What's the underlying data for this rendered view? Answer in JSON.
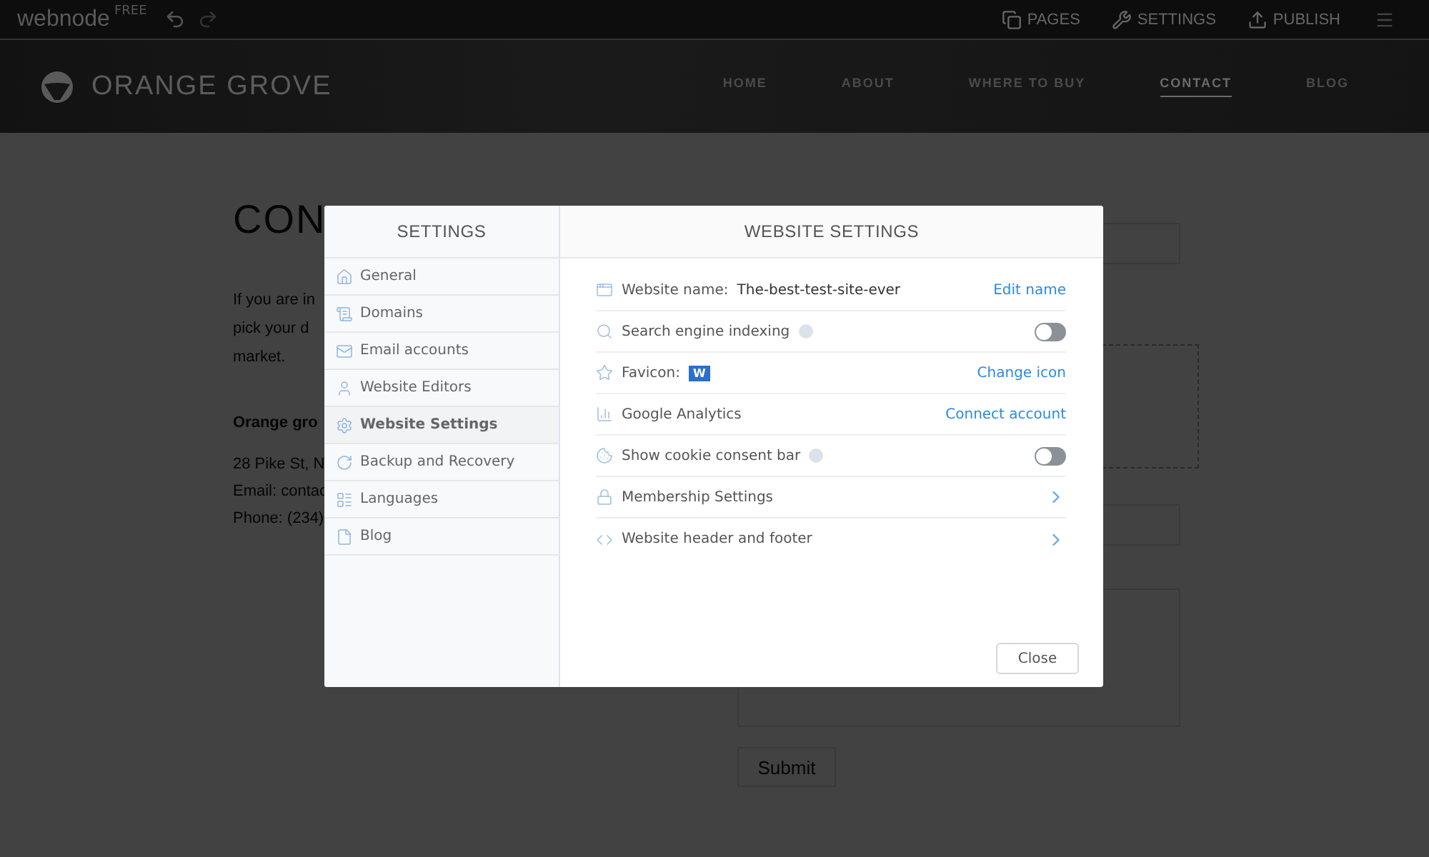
{
  "topbar": {
    "logo": "webnode",
    "badge": "FREE",
    "actions": [
      {
        "kind": "pages",
        "label": "PAGES"
      },
      {
        "kind": "settings",
        "label": "SETTINGS"
      },
      {
        "kind": "publish",
        "label": "PUBLISH"
      }
    ]
  },
  "site_header": {
    "brand": "ORANGE GROVE",
    "nav": [
      {
        "label": "HOME",
        "selected": false
      },
      {
        "label": "ABOUT",
        "selected": false
      },
      {
        "label": "WHERE TO BUY",
        "selected": false
      },
      {
        "label": "CONTACT",
        "selected": true
      },
      {
        "label": "BLOG",
        "selected": false
      }
    ]
  },
  "page": {
    "heading": "CON",
    "paragraph_lines": [
      "If you are in",
      "pick your d",
      "market."
    ],
    "company": "Orange gro",
    "address_lines": [
      "28 Pike St, N",
      "Email: contac",
      "Phone: (234)"
    ],
    "submit": "Submit"
  },
  "dialog": {
    "sidebar": {
      "title": "SETTINGS",
      "items": [
        {
          "kind": "home",
          "label": "General",
          "selected": false
        },
        {
          "kind": "list",
          "label": "Domains",
          "selected": false
        },
        {
          "kind": "mail",
          "label": "Email accounts",
          "selected": false
        },
        {
          "kind": "user",
          "label": "Website Editors",
          "selected": false
        },
        {
          "kind": "gear",
          "label": "Website Settings",
          "selected": true
        },
        {
          "kind": "refresh",
          "label": "Backup and Recovery",
          "selected": false
        },
        {
          "kind": "table",
          "label": "Languages",
          "selected": false
        },
        {
          "kind": "file",
          "label": "Blog",
          "selected": false
        }
      ]
    },
    "title": "WEBSITE SETTINGS",
    "rows": [
      {
        "kind": "link",
        "label": "Website name:",
        "value": "The-best-test-site-ever",
        "action": "Edit name"
      },
      {
        "kind": "toggle",
        "label": "Search engine indexing",
        "on": false
      },
      {
        "kind": "link",
        "label": "Favicon:",
        "favicon": "W",
        "action": "Change icon"
      },
      {
        "kind": "link",
        "label": "Google Analytics",
        "action": "Connect account"
      },
      {
        "kind": "toggle",
        "label": "Show cookie consent bar",
        "on": false
      },
      {
        "kind": "nav",
        "label": "Membership Settings"
      },
      {
        "kind": "nav",
        "label": "Website header and footer"
      }
    ],
    "close": "Close"
  }
}
